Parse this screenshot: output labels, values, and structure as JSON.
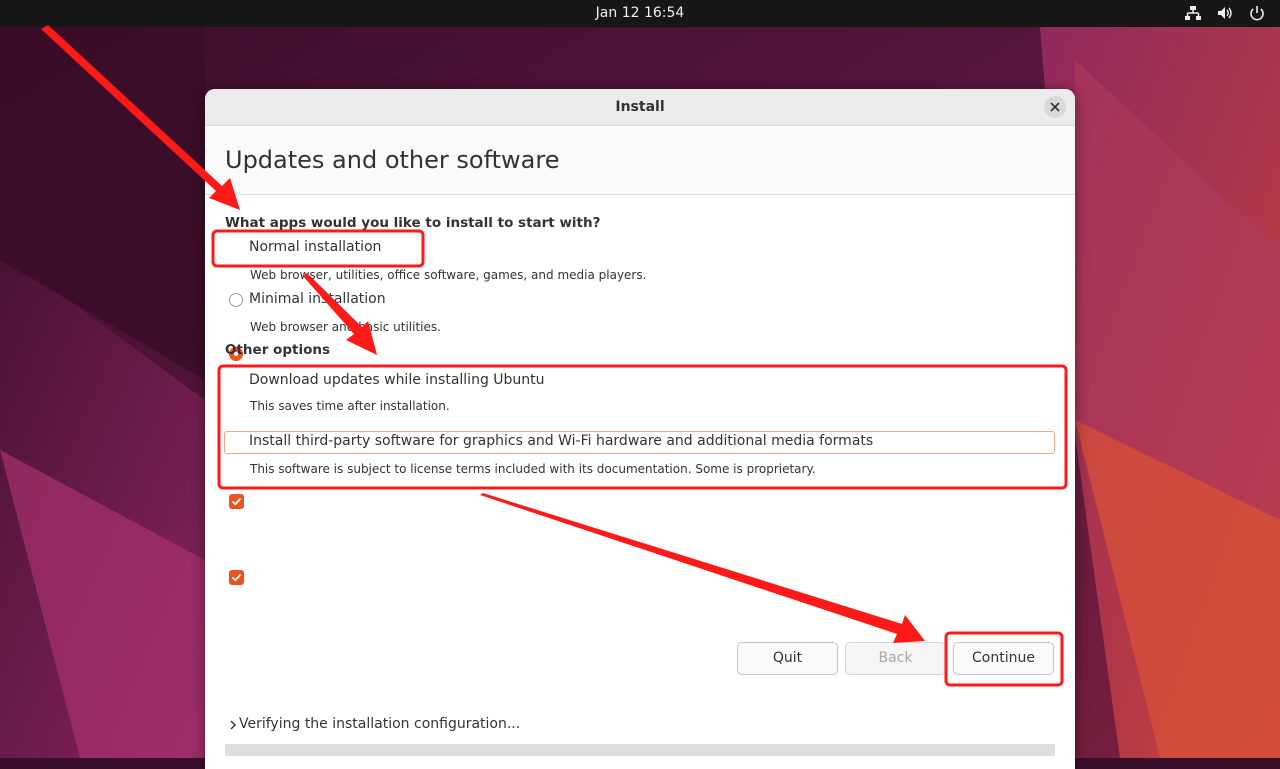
{
  "topbar": {
    "clock": "Jan 12  16:54",
    "tray_icons": [
      "network-icon",
      "volume-icon",
      "power-icon"
    ]
  },
  "window": {
    "title": "Install",
    "close_icon": "close-icon"
  },
  "page": {
    "title": "Updates and other software",
    "question": "What apps would you like to install to start with?",
    "options": [
      {
        "label": "Normal installation",
        "description": "Web browser, utilities, office software, games, and media players.",
        "selected": true
      },
      {
        "label": "Minimal installation",
        "description": "Web browser and basic utilities.",
        "selected": false
      }
    ],
    "other_options_heading": "Other options",
    "checkboxes": [
      {
        "label": "Download updates while installing Ubuntu",
        "description": "This saves time after installation.",
        "checked": true
      },
      {
        "label": "Install third-party software for graphics and Wi-Fi hardware and additional media formats",
        "description": "This software is subject to license terms included with its documentation. Some is proprietary.",
        "checked": true
      }
    ]
  },
  "buttons": {
    "quit": "Quit",
    "back": "Back",
    "continue": "Continue"
  },
  "status": {
    "expander_icon": "chevron-right-icon",
    "text": "Verifying the installation configuration..."
  },
  "colors": {
    "accent": "#e95420",
    "annotation": "#ff1a1a",
    "topbar": "#171717"
  }
}
